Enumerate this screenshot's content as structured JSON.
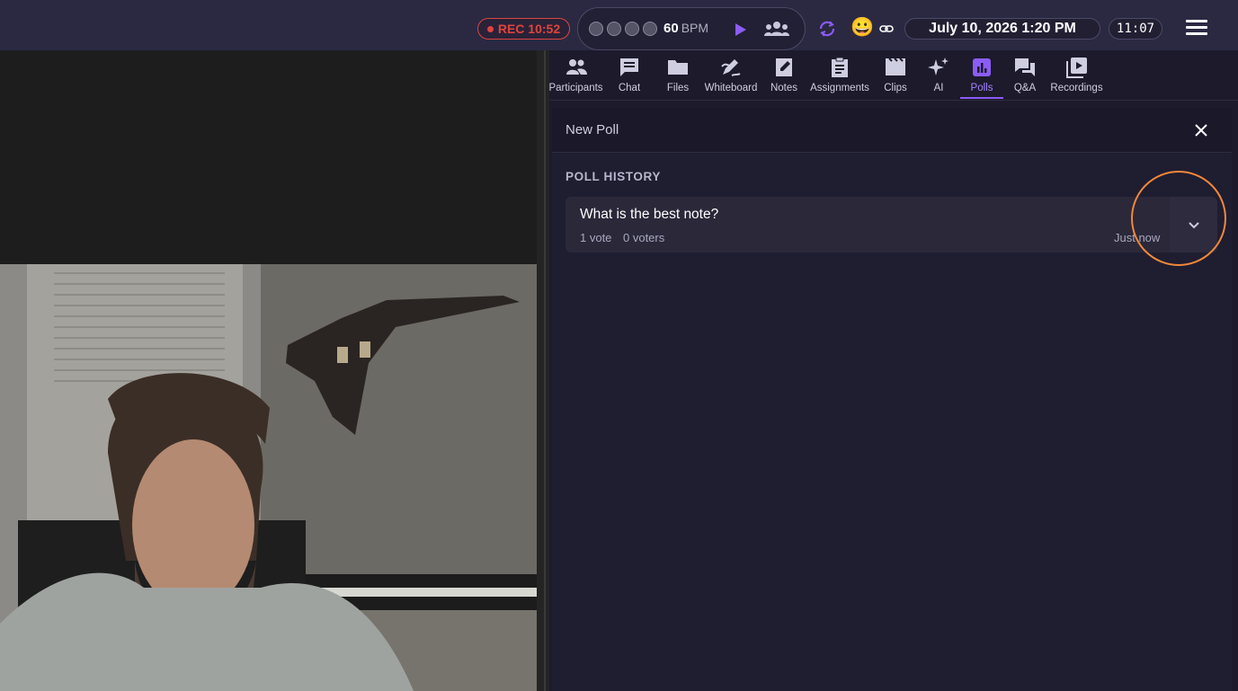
{
  "topbar": {
    "rec_label": "REC 10:52",
    "metronome": {
      "beats": 4,
      "bpm_value": "60",
      "bpm_unit": "BPM"
    },
    "emoji": "😀",
    "datetime": "July 10, 2026 1:20 PM",
    "clock": "11:07",
    "colors": {
      "bar": "#2b2942",
      "rec": "#e0443d",
      "accent": "#8b5cf6"
    }
  },
  "tabs": [
    {
      "label": "Participants",
      "icon": "participants-icon"
    },
    {
      "label": "Chat",
      "icon": "chat-icon"
    },
    {
      "label": "Files",
      "icon": "folder-icon"
    },
    {
      "label": "Whiteboard",
      "icon": "whiteboard-icon"
    },
    {
      "label": "Notes",
      "icon": "notes-icon"
    },
    {
      "label": "Assignments",
      "icon": "assignments-icon"
    },
    {
      "label": "Clips",
      "icon": "clips-icon"
    },
    {
      "label": "AI",
      "icon": "sparkle-icon"
    },
    {
      "label": "Polls",
      "icon": "polls-icon",
      "active": true
    },
    {
      "label": "Q&A",
      "icon": "qa-icon"
    },
    {
      "label": "Recordings",
      "icon": "recordings-icon"
    }
  ],
  "panel": {
    "new_poll": "New Poll",
    "history_heading": "POLL HISTORY",
    "polls": [
      {
        "question": "What is the best note?",
        "votes": "1 vote",
        "voters": "0 voters",
        "time": "Just now"
      }
    ]
  }
}
